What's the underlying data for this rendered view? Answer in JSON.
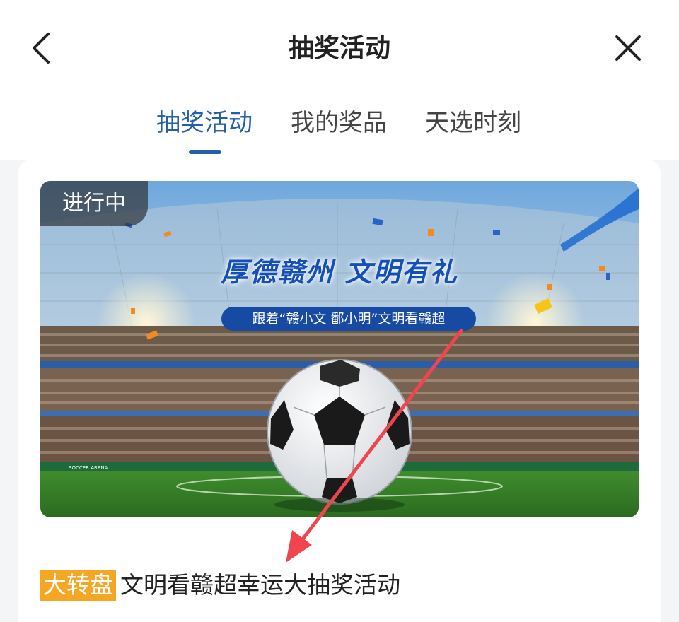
{
  "header": {
    "title": "抽奖活动",
    "back_icon": "chevron-left-icon",
    "close_icon": "close-icon"
  },
  "tabs": [
    {
      "label": "抽奖活动",
      "active": true
    },
    {
      "label": "我的奖品",
      "active": false
    },
    {
      "label": "天选时刻",
      "active": false
    }
  ],
  "activity": {
    "status": "进行中",
    "banner_headline": "厚德赣州  文明有礼",
    "banner_subline": "跟着“赣小文 鄱小明”文明看赣超",
    "banner_ad_board": "SOCCER ARENA",
    "type_tag": "大转盘",
    "title": "文明看赣超幸运大抽奖活动"
  },
  "colors": {
    "accent": "#2360a8",
    "tag": "#f5a623",
    "annotation_arrow": "#f0454f"
  }
}
